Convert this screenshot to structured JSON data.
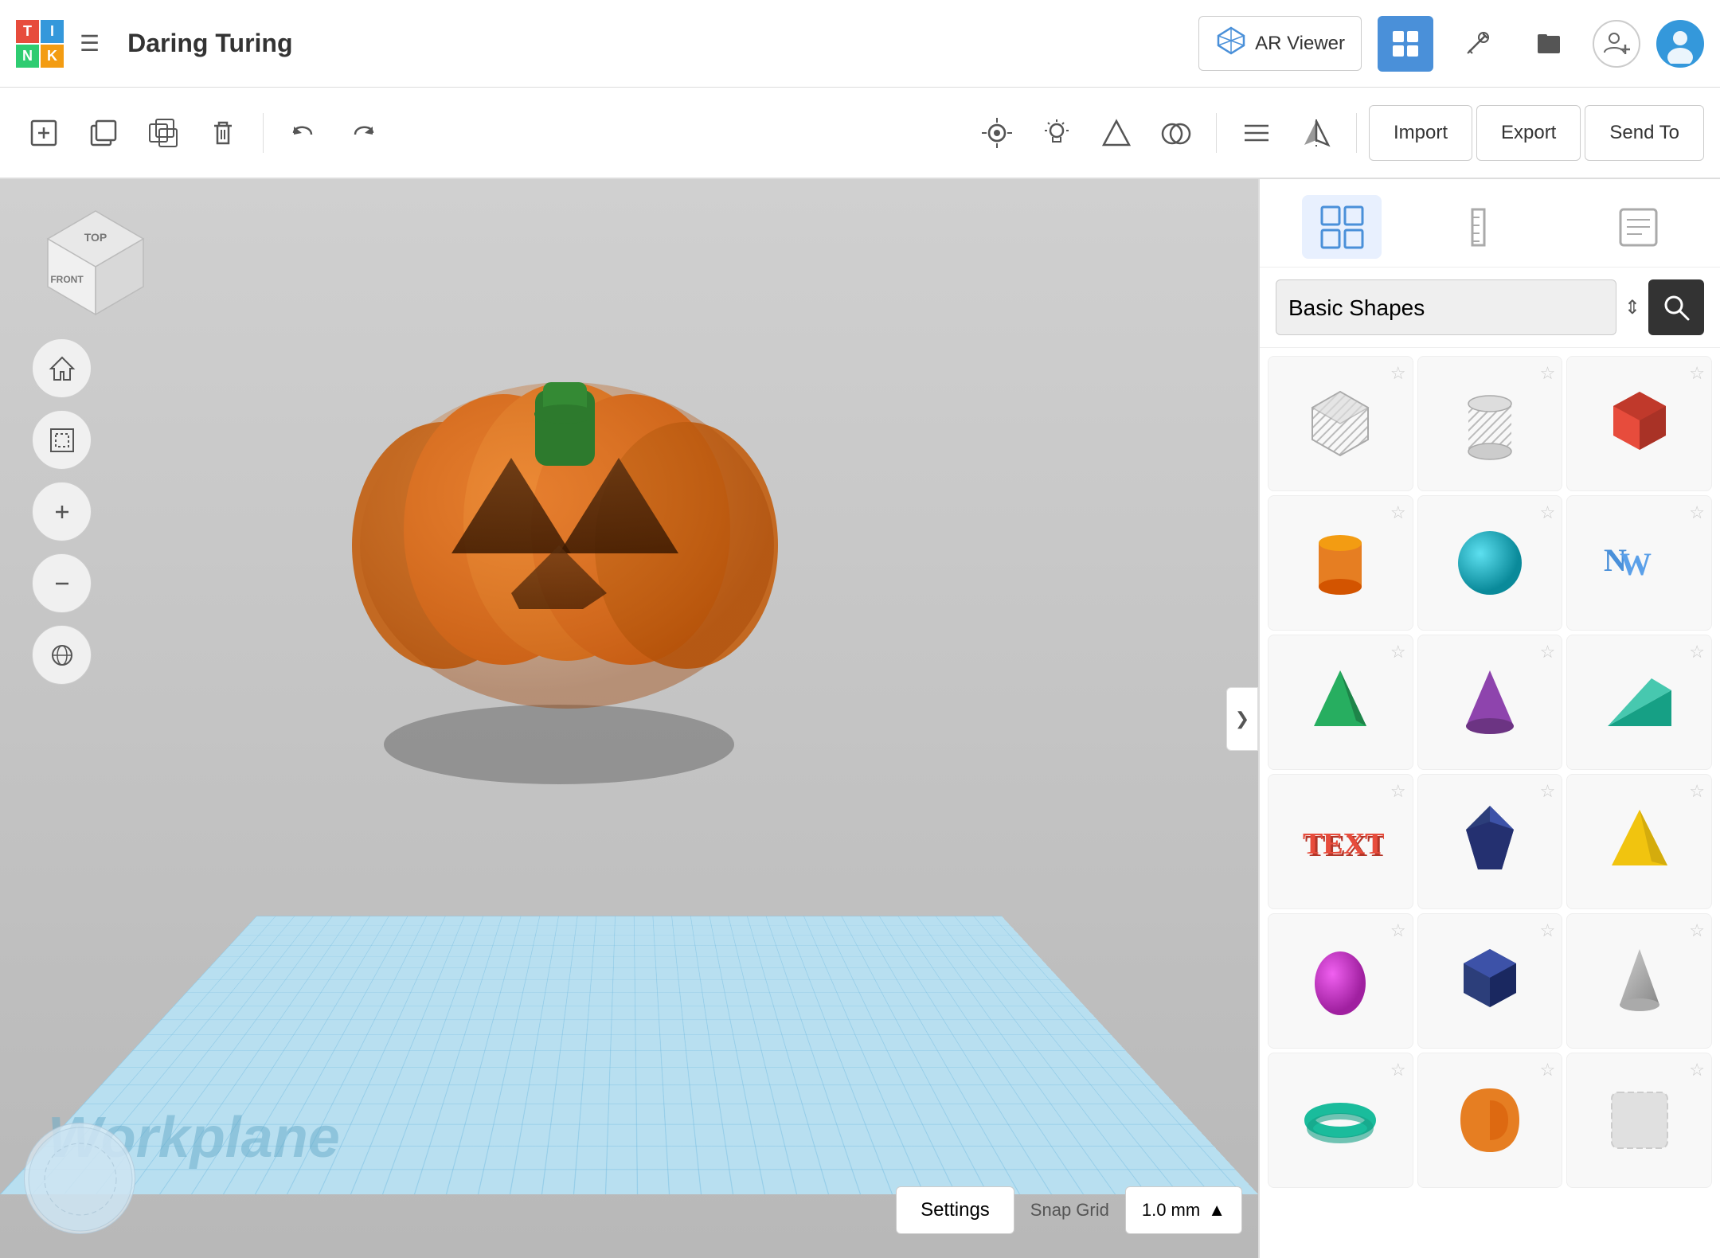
{
  "topbar": {
    "logo": {
      "t": "T",
      "i": "I",
      "n": "N",
      "k": "K"
    },
    "menu_icon": "☰",
    "title": "Daring Turing",
    "ar_viewer_label": "AR Viewer",
    "icons": {
      "grid_icon": "⊞",
      "tool_icon": "⚒",
      "file_icon": "▬",
      "user_add_icon": "👤+",
      "user_avatar_label": "U"
    }
  },
  "toolbar": {
    "copy_icon": "⧉",
    "paste_icon": "📋",
    "duplicate_icon": "⬜",
    "delete_icon": "🗑",
    "undo_icon": "↩",
    "redo_icon": "↪",
    "camera_icon": "⊙",
    "light_icon": "💡",
    "shape_icon": "⬡",
    "mirror_icon": "⬡",
    "align_icon": "⬡",
    "flip_icon": "⬡",
    "import_label": "Import",
    "export_label": "Export",
    "send_to_label": "Send To"
  },
  "viewport": {
    "workplane_label": "Workplane",
    "settings_label": "Settings",
    "snap_grid_label": "Snap Grid",
    "snap_grid_value": "1.0 mm",
    "collapse_icon": "❯",
    "view_cube": {
      "top_label": "TOP",
      "front_label": "FRONT",
      "side_label": ""
    }
  },
  "left_controls": {
    "home_icon": "⌂",
    "frame_icon": "⊡",
    "zoom_in_icon": "+",
    "zoom_out_icon": "−",
    "view_icon": "⊕"
  },
  "panel": {
    "tabs": [
      {
        "id": "grid",
        "icon": "⊞",
        "active": true
      },
      {
        "id": "ruler",
        "icon": "📐",
        "active": false
      },
      {
        "id": "notes",
        "icon": "📄",
        "active": false
      }
    ],
    "shape_category": "Basic Shapes",
    "search_icon": "🔍",
    "dropdown_arrow": "⇕",
    "shapes": [
      [
        {
          "id": "box-stripes",
          "color": "#aaa",
          "type": "stripe-box",
          "star": false
        },
        {
          "id": "cylinder-stripes",
          "color": "#999",
          "type": "stripe-cyl",
          "star": false
        },
        {
          "id": "red-box",
          "color": "#e74c3c",
          "type": "box",
          "star": false
        }
      ],
      [
        {
          "id": "orange-cyl",
          "color": "#e67e22",
          "type": "cylinder",
          "star": false
        },
        {
          "id": "teal-sphere",
          "color": "#1abc9c",
          "type": "sphere",
          "star": false
        },
        {
          "id": "text-3d",
          "color": "#4a90d9",
          "type": "text3d",
          "star": false
        }
      ],
      [
        {
          "id": "green-pyramid",
          "color": "#27ae60",
          "type": "pyramid",
          "star": false
        },
        {
          "id": "purple-cone",
          "color": "#8e44ad",
          "type": "cone",
          "star": false
        },
        {
          "id": "teal-wedge",
          "color": "#16a085",
          "type": "wedge",
          "star": false
        }
      ],
      [
        {
          "id": "text-red",
          "color": "#e74c3c",
          "type": "text-shape",
          "star": false
        },
        {
          "id": "blue-gem",
          "color": "#2c3e7a",
          "type": "gem",
          "star": false
        },
        {
          "id": "yellow-pyramid",
          "color": "#f1c40f",
          "type": "pyramid2",
          "star": false
        }
      ],
      [
        {
          "id": "magenta-egg",
          "color": "#d63fd6",
          "type": "egg",
          "star": false
        },
        {
          "id": "navy-box",
          "color": "#2c3e7a",
          "type": "box2",
          "star": false
        },
        {
          "id": "grey-cone",
          "color": "#aaa",
          "type": "cone2",
          "star": false
        }
      ],
      [
        {
          "id": "teal-torus",
          "color": "#1abc9c",
          "type": "torus",
          "star": false
        },
        {
          "id": "orange-shape",
          "color": "#e67e22",
          "type": "shape2",
          "star": false
        },
        {
          "id": "placeholder",
          "color": "#ddd",
          "type": "empty",
          "star": false
        }
      ]
    ]
  }
}
